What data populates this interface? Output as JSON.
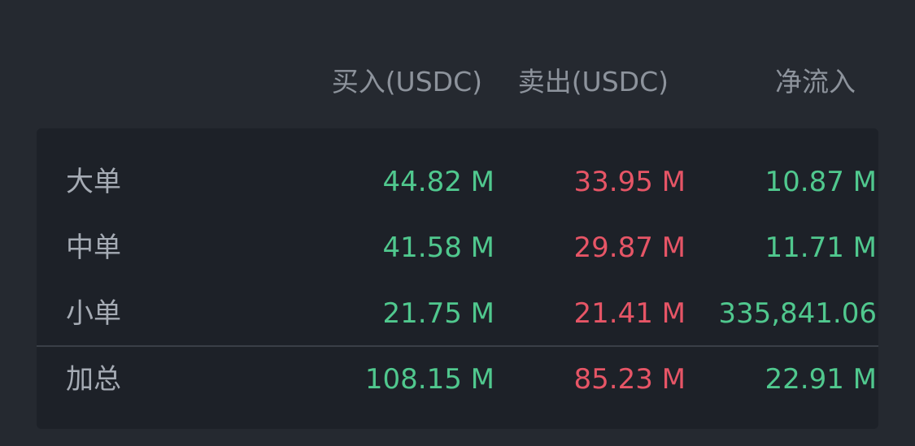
{
  "header": {
    "buy": "买入(USDC)",
    "sell": "卖出(USDC)",
    "net": "净流入"
  },
  "rows": [
    {
      "label": "大单",
      "buy": "44.82 M",
      "sell": "33.95 M",
      "net": "10.87 M"
    },
    {
      "label": "中单",
      "buy": "41.58 M",
      "sell": "29.87 M",
      "net": "11.71 M"
    },
    {
      "label": "小单",
      "buy": "21.75 M",
      "sell": "21.41 M",
      "net": "335,841.06"
    }
  ],
  "total": {
    "label": "加总",
    "buy": "108.15 M",
    "sell": "85.23 M",
    "net": "22.91 M"
  },
  "colors": {
    "background": "#252930",
    "card": "#1d2128",
    "positive": "#50c88e",
    "negative": "#e65566",
    "header_text": "#8d939c",
    "label_text": "#a5abb4"
  }
}
